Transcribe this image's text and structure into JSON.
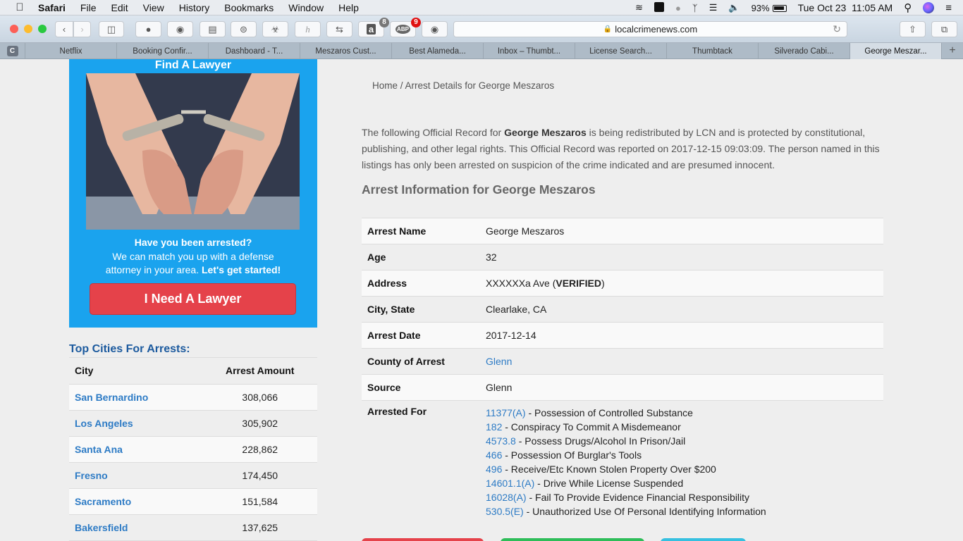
{
  "menubar": {
    "app": "Safari",
    "items": [
      "File",
      "Edit",
      "View",
      "History",
      "Bookmarks",
      "Window",
      "Help"
    ],
    "battery": "93%",
    "datetime": "Tue Oct 23  11:05 AM"
  },
  "toolbar": {
    "url": "localcrimenews.com",
    "extension_badges": {
      "amazon": "8",
      "adblock": "9"
    }
  },
  "tabs": {
    "pinned": "C",
    "items": [
      {
        "label": "Netflix"
      },
      {
        "label": "Booking Confir..."
      },
      {
        "label": "Dashboard - T..."
      },
      {
        "label": "Meszaros Cust..."
      },
      {
        "label": "Best Alameda..."
      },
      {
        "label": "Inbox – Thumbt..."
      },
      {
        "label": "License Search..."
      },
      {
        "label": "Thumbtack"
      },
      {
        "label": "Silverado Cabi..."
      },
      {
        "label": "George Meszar...",
        "active": true
      }
    ],
    "new_tab": "+"
  },
  "ad": {
    "title": "Find A Lawyer",
    "question": "Have you been arrested?",
    "line1": "We can match you up with a defense",
    "line2": "attorney in your area.",
    "cta_text": "Let's get started!",
    "button": "I Need A Lawyer",
    "colors": {
      "background": "#1aa3ee",
      "button": "#e5424a"
    }
  },
  "cities": {
    "title": "Top Cities For Arrests:",
    "headers": [
      "City",
      "Arrest Amount"
    ],
    "rows": [
      {
        "city": "San Bernardino",
        "amount": "308,066"
      },
      {
        "city": "Los Angeles",
        "amount": "305,902"
      },
      {
        "city": "Santa Ana",
        "amount": "228,862"
      },
      {
        "city": "Fresno",
        "amount": "174,450"
      },
      {
        "city": "Sacramento",
        "amount": "151,584"
      },
      {
        "city": "Bakersfield",
        "amount": "137,625"
      }
    ]
  },
  "breadcrumb": {
    "home": "Home",
    "separator": " / ",
    "current": "Arrest Details for George Meszaros"
  },
  "intro": {
    "prefix": "The following Official Record for ",
    "name": "George Meszaros",
    "suffix": " is being redistributed by LCN and is protected by constitutional, publishing, and other legal rights. This Official Record was reported on 2017-12-15 09:03:09. The person named in this listings has only been arrested on suspicion of the crime indicated and are presumed innocent."
  },
  "section_title": "Arrest Information for George Meszaros",
  "details": {
    "arrest_name": {
      "label": "Arrest Name",
      "value": "George Meszaros"
    },
    "age": {
      "label": "Age",
      "value": "32"
    },
    "address": {
      "label": "Address",
      "value": "XXXXXXa Ave (",
      "verified": "VERIFIED",
      "close": ")"
    },
    "city_state": {
      "label": "City, State",
      "value": "Clearlake, CA"
    },
    "arrest_date": {
      "label": "Arrest Date",
      "value": "2017-12-14"
    },
    "county": {
      "label": "County of Arrest",
      "value": "Glenn"
    },
    "source": {
      "label": "Source",
      "value": "Glenn"
    },
    "arrested_for": {
      "label": "Arrested For",
      "charges": [
        {
          "code": "11377(A)",
          "desc": " - Possession of Controlled Substance"
        },
        {
          "code": "182",
          "desc": " - Conspiracy To Commit A Misdemeanor"
        },
        {
          "code": "4573.8",
          "desc": " - Possess Drugs/Alcohol In Prison/Jail"
        },
        {
          "code": "466",
          "desc": " - Possession Of Burglar's Tools"
        },
        {
          "code": "496",
          "desc": " - Receive/Etc Known Stolen Property Over $200"
        },
        {
          "code": "14601.1(A)",
          "desc": " - Drive While License Suspended"
        },
        {
          "code": "16028(A)",
          "desc": " - Fail To Provide Evidence Financial Responsibility"
        },
        {
          "code": "530.5(E)",
          "desc": " - Unauthorized Use Of Personal Identifying Information"
        }
      ]
    }
  },
  "bottom_buttons": {
    "colors": [
      "#e5424a",
      "#2ebd59",
      "#36c0e0"
    ]
  }
}
